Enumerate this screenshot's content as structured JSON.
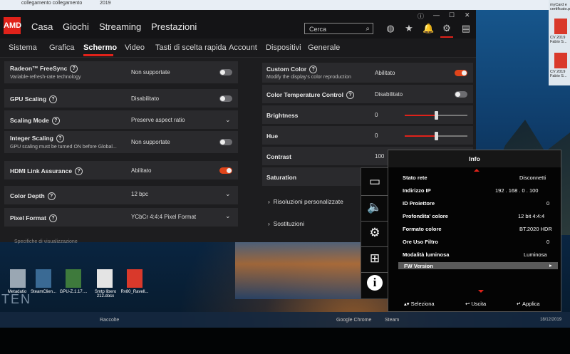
{
  "topstrip": {
    "left_text": "collegamento collegamento",
    "right_text": "2019"
  },
  "app": {
    "logo": "AMD",
    "nav": [
      "Casa",
      "Giochi",
      "Streaming",
      "Prestazioni"
    ],
    "search_placeholder": "Cerca",
    "tabs": [
      "Sistema",
      "Grafica",
      "Schermo",
      "Video",
      "Tasti di scelta rapida",
      "Account",
      "Dispositivi",
      "Generale"
    ],
    "active_tab": "Schermo",
    "left_settings": [
      {
        "label": "Radeon™ FreeSync",
        "sub": "Variable-refresh-rate technology",
        "value": "Non supportate",
        "control": "toggle-off"
      },
      {
        "label": "GPU Scaling",
        "value": "Disabilitato",
        "control": "toggle-off"
      },
      {
        "label": "Scaling Mode",
        "value": "Preserve aspect ratio",
        "control": "dropdown"
      },
      {
        "label": "Integer Scaling",
        "sub": "GPU scaling must be turned ON before Global...",
        "value": "Non supportate",
        "control": "toggle-off"
      },
      {
        "label": "HDMI Link Assurance",
        "value": "Abilitato",
        "control": "toggle-on"
      },
      {
        "label": "Color Depth",
        "value": "12 bpc",
        "control": "dropdown"
      },
      {
        "label": "Pixel Format",
        "value": "YCbCr 4:4:4 Pixel Format",
        "control": "dropdown"
      }
    ],
    "right_settings": [
      {
        "label": "Custom Color",
        "sub": "Modify the display's color reproduction",
        "value": "Abilitato",
        "control": "toggle-on"
      },
      {
        "label": "Color Temperature Control",
        "value": "Disabilitato",
        "control": "toggle-off"
      },
      {
        "label": "Brightness",
        "value": "0",
        "control": "slider"
      },
      {
        "label": "Hue",
        "value": "0",
        "control": "slider"
      },
      {
        "label": "Contrast",
        "value": "100",
        "control": "slider"
      },
      {
        "label": "Saturation",
        "value": "",
        "control": "slider"
      }
    ],
    "expanders": [
      "Risoluzioni personalizzate",
      "Sostituzioni"
    ],
    "partial_bottom_text": "Specifiche di visualizzazione"
  },
  "osd": {
    "title": "Info",
    "side_icons": [
      "display-icon",
      "speaker-icon",
      "gear-icon",
      "network-icon",
      "info-icon"
    ],
    "rows": [
      {
        "key": "Stato rete",
        "value": "Disconnetti"
      },
      {
        "key": "Indirizzo IP",
        "value": "192 . 168 . 0 . 100"
      },
      {
        "key": "ID Proiettore",
        "value": "0"
      },
      {
        "key": "Profondita' colore",
        "value": "12 bit  4:4:4"
      },
      {
        "key": "Formato colore",
        "value": "BT.2020 HDR"
      },
      {
        "key": "Ore Uso Filtro",
        "value": "0"
      },
      {
        "key": "Modalità luminosa",
        "value": "Luminosa"
      },
      {
        "key": "FW Version",
        "value": ""
      }
    ],
    "footer": [
      "Seleziona",
      "Uscita",
      "Applica"
    ]
  },
  "desktop_icons": [
    "Metadatio",
    "SteamClien...",
    "GPU-Z.1.17....",
    "Smtp libero 212.docx",
    "Rv80_Ravell..."
  ],
  "watermark": "TEN",
  "right_desktop": [
    {
      "label": "myCard e certificato.pdf"
    },
    {
      "label": "CV 2019 Fabio S..."
    },
    {
      "label": "CV 2019 Fabio S..."
    }
  ],
  "taskbar": {
    "items": [
      "Raccolte",
      "Google Chrome",
      "Steam"
    ],
    "date": "18/12/2019"
  }
}
